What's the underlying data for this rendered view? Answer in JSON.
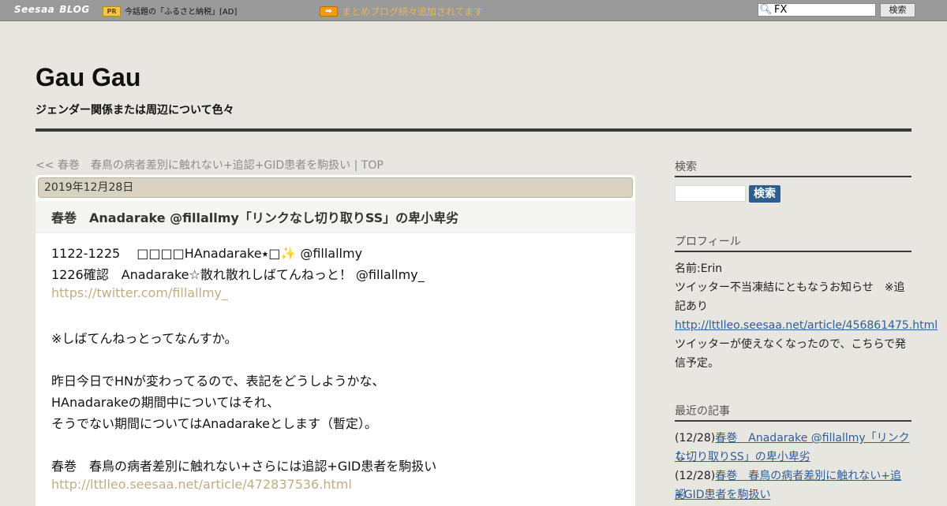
{
  "topbar": {
    "logo_brand": "Seesaa",
    "logo_blog": "BLOG",
    "pr_badge": "PR",
    "pr_text": "今話題の「ふるさと納税」[AD]",
    "arrow_badge": "➡",
    "notice": "まとめブログ続々追加されてます",
    "search_value": "FX",
    "search_button": "検索"
  },
  "header": {
    "title": "Gau Gau",
    "description": "ジェンダー関係または周辺について色々"
  },
  "breadcrumb": {
    "prev_prefix": "<< ",
    "prev_title": "春巻　春鳥の病者差別に触れない+追認+GID患者を駒扱い",
    "separator": " | ",
    "top": "TOP"
  },
  "article": {
    "date": "2019年12月28日",
    "title": "春巻　Anadarake @fillallmy「リンクなし切り取りSS」の卑小卑劣",
    "lines": {
      "l1": "1122-1225　 □□□□HAnadarake⭑□✨ @fillallmy",
      "l2": "1226確認　Anadarake☆散れ散れしばてんねっと！ @fillallmy_",
      "l3": "https://twitter.com/fillallmy_",
      "l4": "※しばてんねっとってなんすか。",
      "l5": "昨日今日でHNが変わってるので、表記をどうしようかな、",
      "l6": "HAnadarakeの期間中についてはそれ、",
      "l7": "そうでない期間についてはAnadarakeとします（暫定）。",
      "l8": "春巻　春鳥の病者差別に触れない+さらには追認+GID患者を駒扱い",
      "l9": "http://lttlleo.seesaa.net/article/472837536.html"
    }
  },
  "sidebar": {
    "search_heading": "検索",
    "search_button": "検索",
    "profile_heading": "プロフィール",
    "profile_name": "名前:Erin",
    "profile_note_1": "ツイッター不当凍結にともなうお知らせ　※追",
    "profile_note_2": "記あり",
    "profile_link": "http://lttlleo.seesaa.net/article/456861475.html",
    "profile_after_1": "ツイッターが使えなくなったので、こちらで発",
    "profile_after_2": "信予定。",
    "recent_heading": "最近の記事",
    "recent": [
      {
        "date": "(12/28)",
        "title_1": "春巻　Anadarake @fillallmy「リンクな",
        "title_2": "し切り取りSS」の卑小卑劣"
      },
      {
        "date": "(12/28)",
        "title_1": "春巻　春鳥の病者差別に触れない+追認",
        "title_2": "+GID患者を駒扱い"
      }
    ]
  }
}
